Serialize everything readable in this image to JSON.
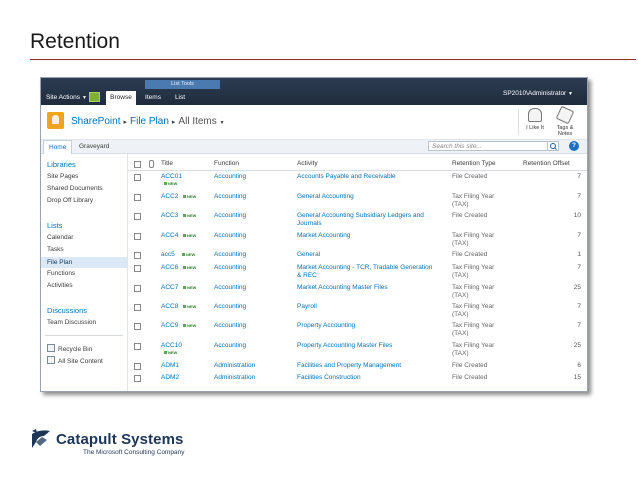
{
  "slide": {
    "title": "Retention"
  },
  "ribbon": {
    "site_actions": "Site Actions",
    "context_group": "List Tools",
    "tabs": [
      "Browse",
      "Items",
      "List"
    ],
    "user": "SP2010\\Administrator"
  },
  "titlebar": {
    "site": "SharePoint",
    "list": "File Plan",
    "view": "All Items",
    "i_like_it": "I Like It",
    "tags_notes_1": "Tags &",
    "tags_notes_2": "Notes"
  },
  "topnav": {
    "home": "Home",
    "graveyard": "Graveyard",
    "search_placeholder": "Search this site...",
    "help": "?"
  },
  "leftnav": {
    "libraries_heading": "Libraries",
    "libraries": [
      "Site Pages",
      "Shared Documents",
      "Drop Off Library"
    ],
    "lists_heading": "Lists",
    "lists": [
      "Calendar",
      "Tasks",
      "File Plan",
      "Functions",
      "Activities"
    ],
    "discussions_heading": "Discussions",
    "discussions": [
      "Team Discussion"
    ],
    "recycle_bin": "Recycle Bin",
    "all_site_content": "All Site Content"
  },
  "table": {
    "columns": [
      "Title",
      "Function",
      "Activity",
      "Retention Type",
      "Retention Offset"
    ],
    "new_badge": "NEW",
    "rows": [
      {
        "title": "ACC01",
        "function": "Accounting",
        "activity": [
          "Accounts Payable and Receivable"
        ],
        "type": [
          "File Created"
        ],
        "offset": "7"
      },
      {
        "title": "ACC2",
        "function": "Accounting",
        "activity": [
          "General Accounting"
        ],
        "type": [
          "Tax Filing Year",
          "(TAX)"
        ],
        "offset": "7"
      },
      {
        "title": "ACC3",
        "function": "Accounting",
        "activity": [
          "General Accounting Subsidiary Ledgers and",
          "Journals"
        ],
        "type": [
          "File Created"
        ],
        "offset": "10"
      },
      {
        "title": "ACC4",
        "function": "Accounting",
        "activity": [
          "Market Accounting"
        ],
        "type": [
          "Tax Filing Year",
          "(TAX)"
        ],
        "offset": "7"
      },
      {
        "title": "acc5",
        "function": "Accounting",
        "activity": [
          "General"
        ],
        "type": [
          "File Created"
        ],
        "offset": "1"
      },
      {
        "title": "ACC6",
        "function": "Accounting",
        "activity": [
          "Market Accounting - TCR, Tradable Generation",
          "& REC"
        ],
        "type": [
          "Tax Filing Year",
          "(TAX)"
        ],
        "offset": "7"
      },
      {
        "title": "ACC7",
        "function": "Accounting",
        "activity": [
          "Market Accounting Master Files"
        ],
        "type": [
          "Tax Filing Year",
          "(TAX)"
        ],
        "offset": "25"
      },
      {
        "title": "ACC8",
        "function": "Accounting",
        "activity": [
          "Payroll"
        ],
        "type": [
          "Tax Filing Year",
          "(TAX)"
        ],
        "offset": "7"
      },
      {
        "title": "ACC9",
        "function": "Accounting",
        "activity": [
          "Property Accounting"
        ],
        "type": [
          "Tax Filing Year",
          "(TAX)"
        ],
        "offset": "7"
      },
      {
        "title": "ACC10",
        "function": "Accounting",
        "activity": [
          "Property Accounting Master Files"
        ],
        "type": [
          "Tax Filing Year",
          "(TAX)"
        ],
        "offset": "25"
      },
      {
        "title": "ADM1",
        "function": "Administration",
        "activity": [
          "Facilities and Property Management"
        ],
        "type": [
          "File Created"
        ],
        "offset": "6"
      },
      {
        "title": "ADM2",
        "function": "Administration",
        "activity": [
          "Facilities Construction"
        ],
        "type": [
          "File Created"
        ],
        "offset": "15"
      }
    ]
  },
  "footer": {
    "company": "Catapult Systems",
    "tagline": "The Microsoft Consulting Company"
  },
  "colors": {
    "accent_rule": "#9b2a2a",
    "link": "#0072bc",
    "ribbon": "#2c3c52"
  }
}
